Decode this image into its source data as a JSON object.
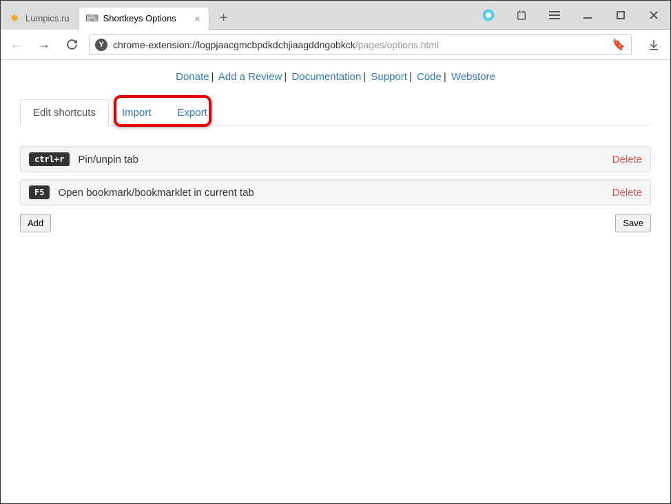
{
  "browser": {
    "tabs": [
      {
        "title": "Lumpics.ru",
        "icon": "lumpics",
        "active": false
      },
      {
        "title": "Shortkeys Options",
        "icon": "shortkeys",
        "active": true
      }
    ],
    "url": "chrome-extension://logpjaacgmcbpdkdchjiaagddngobkck/pages/options.html",
    "url_suffix": "/pages/options.html",
    "url_prefix": "chrome-extension://logpjaacgmcbpdkdchjiaagddngobkck"
  },
  "top_links": {
    "donate": "Donate",
    "review": "Add a Review",
    "docs": "Documentation",
    "support": "Support",
    "code": "Code",
    "webstore": "Webstore"
  },
  "nav_tabs": {
    "edit": "Edit shortcuts",
    "import": "Import",
    "export": "Export"
  },
  "shortcuts": [
    {
      "key": "ctrl+r",
      "label": "Pin/unpin tab",
      "delete": "Delete"
    },
    {
      "key": "F5",
      "label": "Open bookmark/bookmarklet in current tab",
      "delete": "Delete"
    }
  ],
  "buttons": {
    "add": "Add",
    "save": "Save"
  }
}
